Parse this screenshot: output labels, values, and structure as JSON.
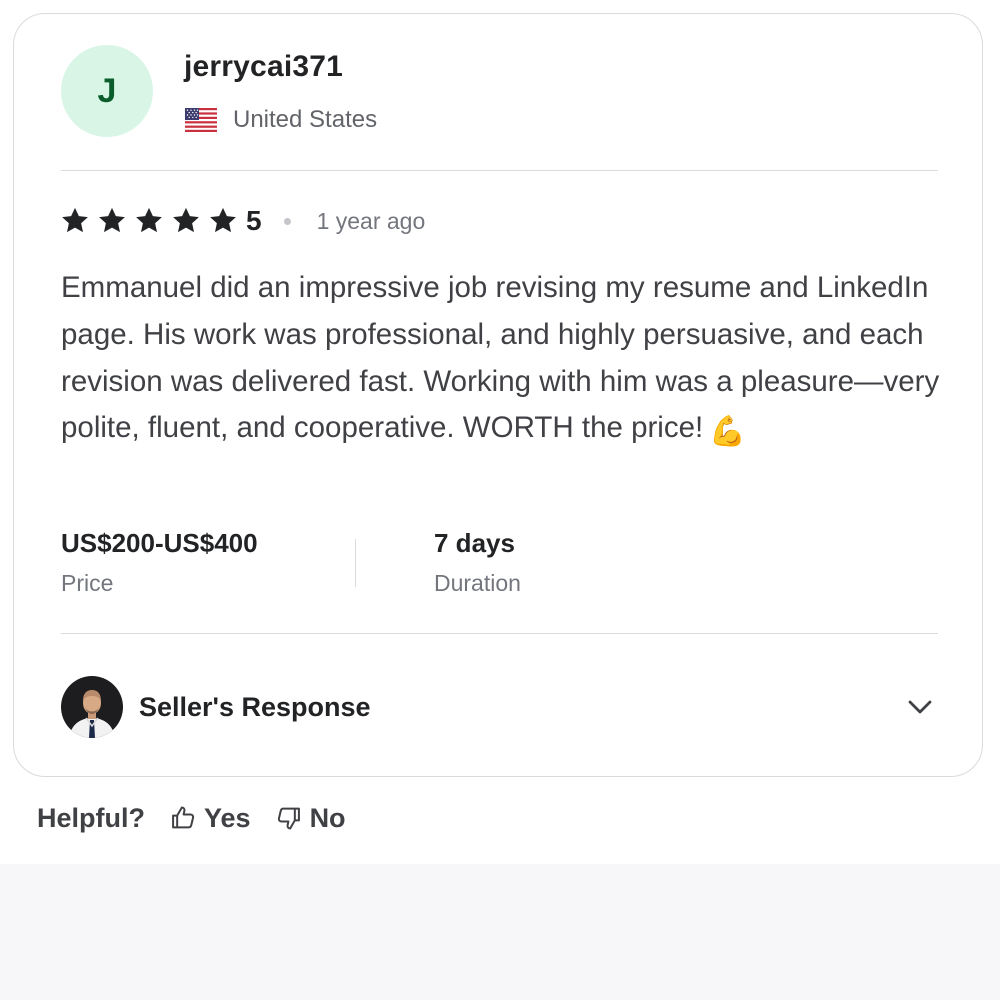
{
  "reviewer": {
    "initial": "J",
    "username": "jerrycai371",
    "country": "United States",
    "flag_icon": "us-flag-icon"
  },
  "rating": {
    "stars": 5,
    "value": "5",
    "time_ago": "1 year ago"
  },
  "review": {
    "text": "Emmanuel did an impressive job revising my resume and LinkedIn page. His work was professional, and highly persuasive, and each revision was delivered fast. Working with him was a pleasure—very polite, fluent, and cooperative. WORTH the price!",
    "emoji": "💪"
  },
  "stats": {
    "price": {
      "value": "US$200-US$400",
      "label": "Price"
    },
    "duration": {
      "value": "7 days",
      "label": "Duration"
    }
  },
  "seller_response": {
    "label": "Seller's Response",
    "expand_icon": "chevron-down-icon"
  },
  "helpful": {
    "label": "Helpful?",
    "yes_label": "Yes",
    "no_label": "No"
  },
  "colors": {
    "avatar_bg": "#d8f5e6",
    "avatar_text": "#0b5d2c",
    "text_primary": "#222325",
    "text_secondary": "#74767e",
    "border": "#dadbdd"
  }
}
